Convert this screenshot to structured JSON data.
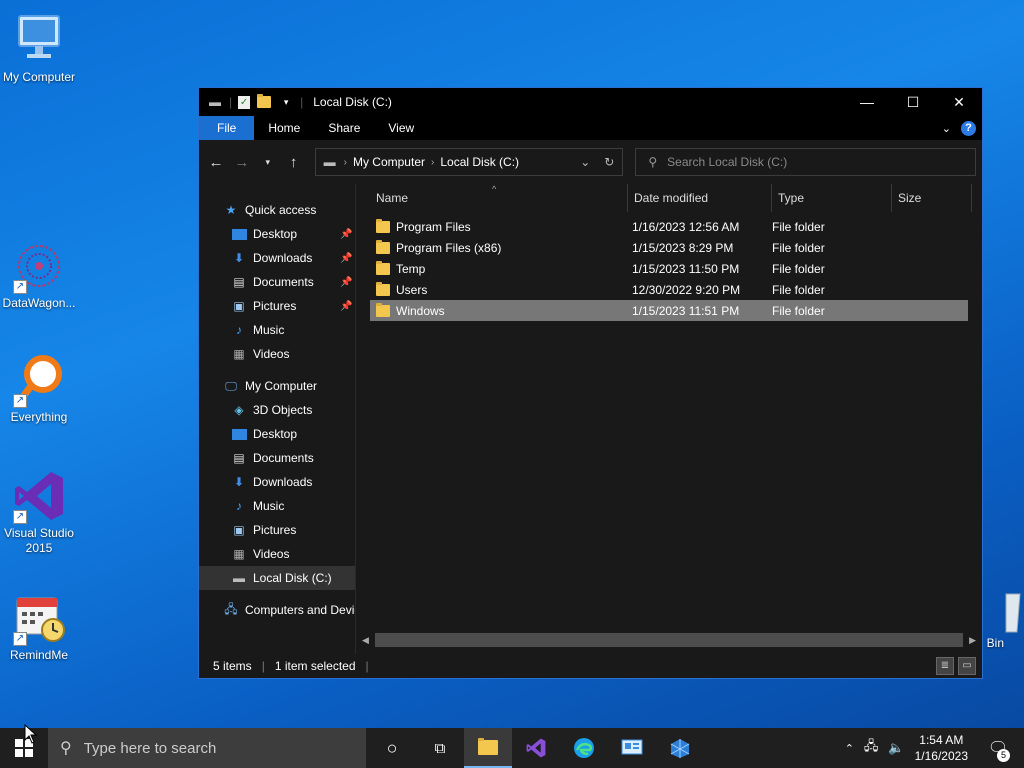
{
  "desktop": {
    "icons": [
      {
        "label": "My Computer",
        "icon": "monitor-icon"
      },
      {
        "label": "DataWagon...",
        "icon": "datawagon-icon"
      },
      {
        "label": "Everything",
        "icon": "magnifier-icon"
      },
      {
        "label": "Visual Studio 2015",
        "icon": "visual-studio-icon"
      },
      {
        "label": "RemindMe",
        "icon": "calendar-clock-icon"
      },
      {
        "label": "Bin",
        "icon": "recycle-bin-icon"
      }
    ]
  },
  "window": {
    "title": "Local Disk (C:)",
    "ribbon_tabs": [
      "File",
      "Home",
      "Share",
      "View"
    ],
    "help": "?",
    "address": {
      "segments": [
        "My Computer",
        "Local Disk (C:)"
      ]
    },
    "search": {
      "placeholder": "Search Local Disk (C:)"
    },
    "nav": {
      "quick_access": "Quick access",
      "quick_items": [
        "Desktop",
        "Downloads",
        "Documents",
        "Pictures",
        "Music",
        "Videos"
      ],
      "my_computer": "My Computer",
      "computer_items": [
        "3D Objects",
        "Desktop",
        "Documents",
        "Downloads",
        "Music",
        "Pictures",
        "Videos",
        "Local Disk (C:)"
      ],
      "network": "Computers and Devic"
    },
    "columns": [
      "Name",
      "Date modified",
      "Type",
      "Size"
    ],
    "files": [
      {
        "name": "Program Files",
        "date": "1/16/2023 12:56 AM",
        "type": "File folder"
      },
      {
        "name": "Program Files (x86)",
        "date": "1/15/2023 8:29 PM",
        "type": "File folder"
      },
      {
        "name": "Temp",
        "date": "1/15/2023 11:50 PM",
        "type": "File folder"
      },
      {
        "name": "Users",
        "date": "12/30/2022 9:20 PM",
        "type": "File folder"
      },
      {
        "name": "Windows",
        "date": "1/15/2023 11:51 PM",
        "type": "File folder",
        "selected": true
      }
    ],
    "status": {
      "items": "5 items",
      "selected": "1 item selected"
    }
  },
  "taskbar": {
    "search_placeholder": "Type here to search",
    "time": "1:54 AM",
    "date": "1/16/2023",
    "notification_count": "5"
  },
  "colors": {
    "accent": "#1a6fd0",
    "selection": "#777777",
    "folder": "#f3c64d"
  }
}
